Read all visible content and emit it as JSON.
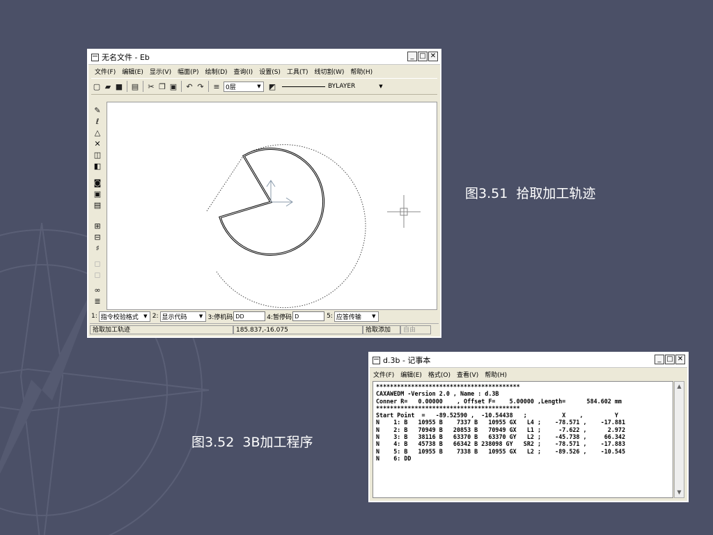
{
  "cad_window": {
    "title": "无名文件 - Eb",
    "menus": [
      "文件(F)",
      "编辑(E)",
      "显示(V)",
      "幅面(P)",
      "绘制(D)",
      "查询(I)",
      "设置(S)",
      "工具(T)",
      "线切割(W)",
      "帮助(H)"
    ],
    "layer_value": "0层",
    "linetype_value": "BYLAYER",
    "bottom": {
      "label1": "1:",
      "select1": "指令校验格式",
      "label2": "2:",
      "select2": "显示代码",
      "label3": "3:停机码",
      "field3": "DD",
      "label4": "4:暂停码",
      "field4": "D",
      "label5": "5:",
      "select5": "应答传输"
    },
    "status": {
      "prompt": "拾取加工轨迹",
      "coords": "185.837,-16.075",
      "mode": "拾取添加",
      "toggle": "自由"
    }
  },
  "notepad_window": {
    "title": "d.3b - 记事本",
    "menus": [
      "文件(F)",
      "编辑(E)",
      "格式(O)",
      "查看(V)",
      "帮助(H)"
    ],
    "lines": [
      "*****************************************",
      "CAXAWEDM -Version 2.0 , Name : d.3B",
      "Conner R=   0.00000    , Offset F=    5.00000 ,Length=      584.602 mm",
      "*****************************************",
      "Start Point  =   -89.52590 ,  -10.54438   ;          X    ,         Y",
      "N    1: B   10955 B    7337 B   10955 GX   L4 ;    -78.571 ,    -17.881",
      "N    2: B   70949 B   20853 B   70949 GX   L1 ;     -7.622 ,      2.972",
      "N    3: B   38116 B   63370 B   63370 GY   L2 ;    -45.738 ,     66.342",
      "N    4: B   45738 B   66342 B 238098 GY   SR2 ;    -78.571 ,    -17.883",
      "N    5: B   10955 B    7338 B   10955 GX   L2 ;    -89.526 ,    -10.545",
      "N    6: DD"
    ]
  },
  "captions": {
    "fig351": "图3.51  拾取加工轨迹",
    "fig352": "图3.52  3B加工程序"
  },
  "colors": {
    "background": "#4b5067",
    "window_face": "#ece9d8",
    "caption_text": "#ffffff"
  }
}
